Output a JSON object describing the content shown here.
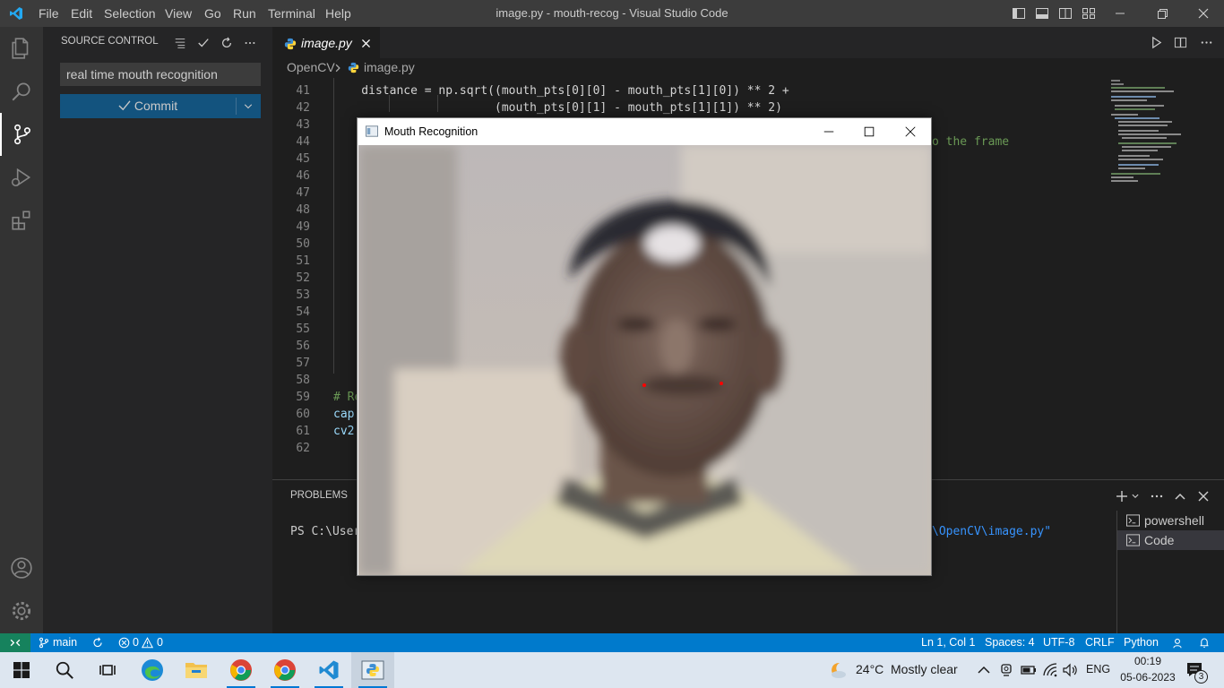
{
  "titlebar": {
    "menu": [
      "File",
      "Edit",
      "Selection",
      "View",
      "Go",
      "Run",
      "Terminal",
      "Help"
    ],
    "window_title": "image.py - mouth-recog - Visual Studio Code"
  },
  "sidebar": {
    "title": "SOURCE CONTROL",
    "commit_message": "real time mouth recognition",
    "commit_label": "Commit"
  },
  "editor": {
    "tab_name": "image.py",
    "breadcrumb": [
      "OpenCV",
      "image.py"
    ],
    "lines": [
      {
        "n": "41",
        "text": "    distance = np.sqrt((mouth_pts[0][0] - mouth_pts[1][0]) ** 2 +"
      },
      {
        "n": "42",
        "text": "                       (mouth_pts[0][1] - mouth_pts[1][1]) ** 2)"
      },
      {
        "n": "43",
        "text": ""
      },
      {
        "n": "44",
        "text": ""
      },
      {
        "n": "45",
        "text": ""
      },
      {
        "n": "46",
        "text": ""
      },
      {
        "n": "47",
        "text": ""
      },
      {
        "n": "48",
        "text": ""
      },
      {
        "n": "49",
        "text": ""
      },
      {
        "n": "50",
        "text": ""
      },
      {
        "n": "51",
        "text": ""
      },
      {
        "n": "52",
        "text": ""
      },
      {
        "n": "53",
        "text": ""
      },
      {
        "n": "54",
        "text": ""
      },
      {
        "n": "55",
        "text": ""
      },
      {
        "n": "56",
        "text": ""
      },
      {
        "n": "57",
        "text": ""
      },
      {
        "n": "58",
        "text": ""
      },
      {
        "n": "59",
        "text": "# Re"
      },
      {
        "n": "60",
        "text": "cap."
      },
      {
        "n": "61",
        "text": "cv2."
      },
      {
        "n": "62",
        "text": ""
      }
    ],
    "line44_tail": "o the frame"
  },
  "panel": {
    "tab": "PROBLEMS",
    "terminal_prompt": "PS C:\\Users",
    "terminal_tail": "\\OpenCV\\image.py\"",
    "terminals": [
      "powershell",
      "Code"
    ]
  },
  "camera_window": {
    "title": "Mouth Recognition"
  },
  "statusbar": {
    "branch": "main",
    "errors": "0",
    "warnings": "0",
    "position": "Ln 1, Col 1",
    "spaces": "Spaces: 4",
    "encoding": "UTF-8",
    "eol": "CRLF",
    "language": "Python"
  },
  "taskbar": {
    "weather_temp": "24°C",
    "weather_desc": "Mostly clear",
    "lang": "ENG",
    "time": "00:19",
    "date": "05-06-2023",
    "notifications": "3"
  },
  "colors": {
    "accent": "#007acc",
    "commit_button": "#0e639c",
    "mouth_point": "#ff0000"
  }
}
